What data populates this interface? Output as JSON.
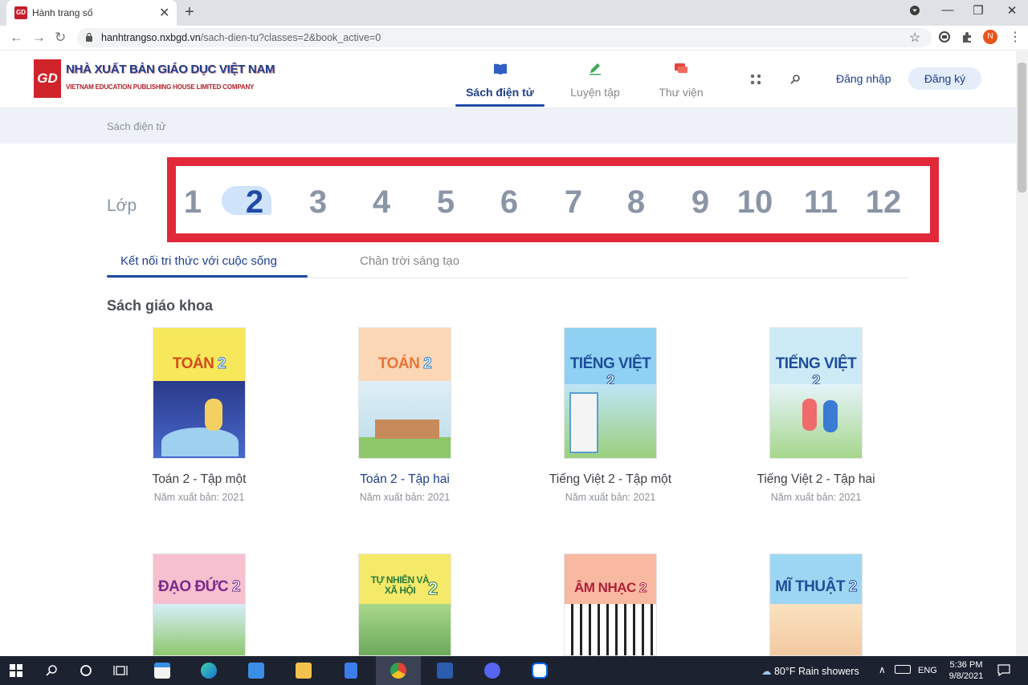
{
  "browser": {
    "tab_title": "Hành trang số",
    "url_host": "hanhtrangso.nxbgd.vn",
    "url_path": "/sach-dien-tu?classes=2&book_active=0",
    "profile_initial": "N"
  },
  "site": {
    "logo_mark": "GD",
    "logo_line1": "NHÀ XUẤT BẢN GIÁO DỤC VIỆT NAM",
    "logo_line2": "VIETNAM EDUCATION PUBLISHING HOUSE LIMITED COMPANY",
    "nav": [
      {
        "label": "Sách điện tử",
        "icon": "book-icon",
        "active": true
      },
      {
        "label": "Luyện tập",
        "icon": "pencil-icon",
        "active": false
      },
      {
        "label": "Thư viện",
        "icon": "chat-icon",
        "active": false
      }
    ],
    "login_label": "Đăng nhập",
    "signup_label": "Đăng ký",
    "accent_color": "#1f4aa8",
    "highlight_color": "#e1293a"
  },
  "breadcrumb": "Sách điện tử",
  "grade_picker": {
    "label": "Lớp",
    "grades": [
      "1",
      "2",
      "3",
      "4",
      "5",
      "6",
      "7",
      "8",
      "9",
      "10",
      "11",
      "12"
    ],
    "selected": "2"
  },
  "series_tabs": [
    {
      "label": "Kết nối tri thức với cuộc sống",
      "active": true
    },
    {
      "label": "Chân trời sáng tạo",
      "active": false
    }
  ],
  "section_title": "Sách giáo khoa",
  "books": [
    {
      "cover_title": "TOÁN",
      "cover_num": "2",
      "title": "Toán 2 - Tập một",
      "year": "Năm xuất bản: 2021"
    },
    {
      "cover_title": "TOÁN",
      "cover_num": "2",
      "title": "Toán 2 - Tập hai",
      "year": "Năm xuất bản: 2021"
    },
    {
      "cover_title": "TIẾNG VIỆT",
      "cover_num": "2",
      "title": "Tiếng Việt 2 - Tập một",
      "year": "Năm xuất bản: 2021"
    },
    {
      "cover_title": "TIẾNG VIỆT",
      "cover_num": "2",
      "title": "Tiếng Việt 2 - Tập hai",
      "year": "Năm xuất bản: 2021"
    },
    {
      "cover_title": "ĐẠO ĐỨC",
      "cover_num": "2"
    },
    {
      "cover_title": "TỰ NHIÊN VÀ XÃ HỘI",
      "cover_num": "2"
    },
    {
      "cover_title": "ÂM NHẠC",
      "cover_num": "2"
    },
    {
      "cover_title": "MĨ THUẬT",
      "cover_num": "2"
    }
  ],
  "taskbar": {
    "weather": "80°F  Rain showers",
    "language": "ENG",
    "time": "5:36 PM",
    "date": "9/8/2021"
  }
}
